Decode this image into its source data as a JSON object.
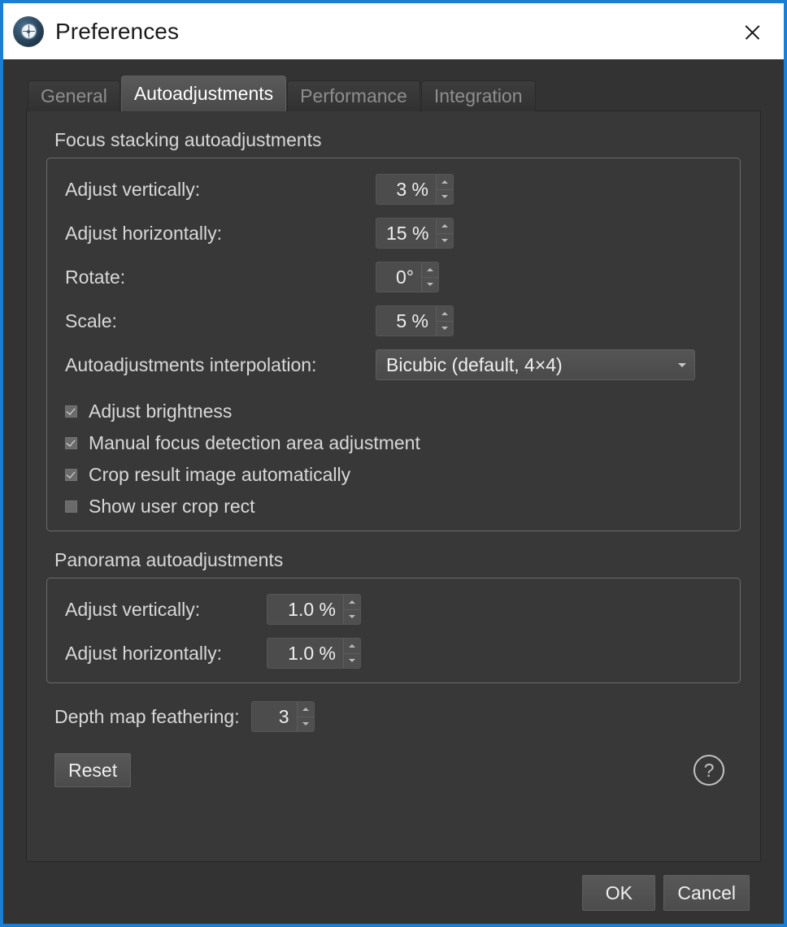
{
  "window": {
    "title": "Preferences",
    "app_icon": "lens-target-icon",
    "close_icon": "close-icon",
    "accent_color": "#1a7fd4",
    "titlebar_bg": "#ffffff",
    "dialog_bg": "#333333"
  },
  "tabs": [
    {
      "label": "General",
      "active": false
    },
    {
      "label": "Autoadjustments",
      "active": true
    },
    {
      "label": "Performance",
      "active": false
    },
    {
      "label": "Integration",
      "active": false
    }
  ],
  "focus_stacking": {
    "group_title": "Focus stacking autoadjustments",
    "fields": [
      {
        "label": "Adjust vertically:",
        "value": "3 %"
      },
      {
        "label": "Adjust horizontally:",
        "value": "15 %"
      },
      {
        "label": "Rotate:",
        "value": "0°"
      },
      {
        "label": "Scale:",
        "value": "5 %"
      }
    ],
    "interpolation": {
      "label": "Autoadjustments interpolation:",
      "value": "Bicubic (default, 4×4)",
      "options": [
        "Bicubic (default, 4×4)"
      ]
    },
    "checkboxes": [
      {
        "label": "Adjust brightness",
        "checked": true
      },
      {
        "label": "Manual focus detection area adjustment",
        "checked": true
      },
      {
        "label": "Crop result image automatically",
        "checked": true
      },
      {
        "label": "Show user crop rect",
        "checked": false
      }
    ]
  },
  "panorama": {
    "group_title": "Panorama autoadjustments",
    "fields": [
      {
        "label": "Adjust vertically:",
        "value": "1.0 %"
      },
      {
        "label": "Adjust horizontally:",
        "value": "1.0 %"
      }
    ]
  },
  "depth_map": {
    "label": "Depth map feathering:",
    "value": "3"
  },
  "actions": {
    "reset_label": "Reset",
    "help_glyph": "?",
    "ok_label": "OK",
    "cancel_label": "Cancel"
  }
}
